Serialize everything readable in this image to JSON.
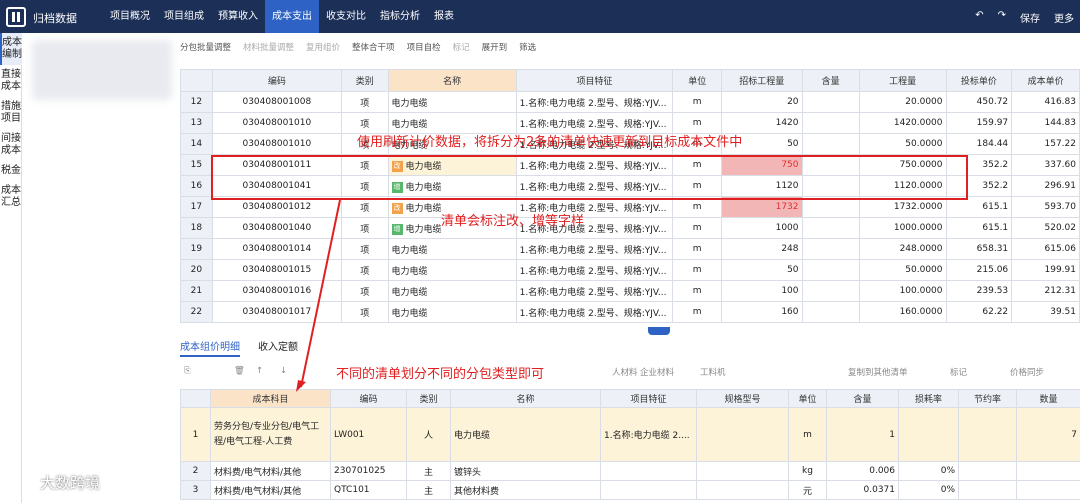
{
  "app": {
    "title": "归档数据"
  },
  "tabs": [
    "项目概况",
    "项目组成",
    "预算收入",
    "成本支出",
    "收支对比",
    "指标分析",
    "报表"
  ],
  "top_actions": [
    "↶",
    "↷",
    "保存",
    "更多"
  ],
  "left_nav": [
    "成本编制",
    "直接成本",
    "措施项目",
    "间接成本",
    "税金",
    "成本汇总"
  ],
  "toolbar": [
    "分包批量调整",
    "材料批量调整",
    "复用组价",
    "整体合干项",
    "项目自检",
    "标记",
    "展开到",
    "筛选"
  ],
  "grid1": {
    "headers": [
      "编码",
      "类别",
      "名称",
      "项目特征",
      "单位",
      "招标工程量",
      "含量",
      "工程量",
      "投标单价",
      "成本单价"
    ],
    "rows": [
      [
        "12",
        "030408001008",
        "项",
        "电力电缆",
        "1.名称:电力电缆 2.型号、规格:YJV...",
        "m",
        "20",
        "",
        "20.0000",
        "450.72",
        "416.83"
      ],
      [
        "13",
        "030408001010",
        "项",
        "电力电缆",
        "1.名称:电力电缆 2.型号、规格:YJV...",
        "m",
        "1420",
        "",
        "1420.0000",
        "159.97",
        "144.83"
      ],
      [
        "14",
        "030408001010",
        "项",
        "电力电缆",
        "1.名称:电力电缆 2.型号、规格:YJV...",
        "m",
        "50",
        "",
        "50.0000",
        "184.44",
        "157.22"
      ],
      [
        "15",
        "030408001011",
        "项",
        "电力电缆",
        "1.名称:电力电缆 2.型号、规格:YJV...",
        "m",
        "750",
        "",
        "750.0000",
        "352.2",
        "337.60"
      ],
      [
        "16",
        "030408001041",
        "项",
        "电力电缆",
        "1.名称:电力电缆 2.型号、规格:YJV...",
        "m",
        "1120",
        "",
        "1120.0000",
        "352.2",
        "296.91"
      ],
      [
        "17",
        "030408001012",
        "项",
        "电力电缆",
        "1.名称:电力电缆 2.型号、规格:YJV...",
        "m",
        "1732",
        "",
        "1732.0000",
        "615.1",
        "593.70"
      ],
      [
        "18",
        "030408001040",
        "项",
        "电力电缆",
        "1.名称:电力电缆 2.型号、规格:YJV...",
        "m",
        "1000",
        "",
        "1000.0000",
        "615.1",
        "520.02"
      ],
      [
        "19",
        "030408001014",
        "项",
        "电力电缆",
        "1.名称:电力电缆 2.型号、规格:YJV...",
        "m",
        "248",
        "",
        "248.0000",
        "658.31",
        "615.06"
      ],
      [
        "20",
        "030408001015",
        "项",
        "电力电缆",
        "1.名称:电力电缆 2.型号、规格:YJV...",
        "m",
        "50",
        "",
        "50.0000",
        "215.06",
        "199.91"
      ],
      [
        "21",
        "030408001016",
        "项",
        "电力电缆",
        "1.名称:电力电缆 2.型号、规格:YJV...",
        "m",
        "100",
        "",
        "100.0000",
        "239.53",
        "212.31"
      ],
      [
        "22",
        "030408001017",
        "项",
        "电力电缆",
        "1.名称:电力电缆 2.型号、规格:YJV...",
        "m",
        "160",
        "",
        "160.0000",
        "62.22",
        "39.51"
      ]
    ],
    "tags": {
      "15": "改",
      "16": "增",
      "17": "改",
      "18": "增"
    }
  },
  "subtabs": [
    "成本组价明细",
    "收入定额"
  ],
  "subbar": [
    "复制到其他清单",
    "标记",
    "价格同步",
    "人材料",
    "企业材料",
    "工料机"
  ],
  "grid2": {
    "headers": [
      "成本科目",
      "编码",
      "类别",
      "名称",
      "项目特征",
      "规格型号",
      "单位",
      "含量",
      "损耗率",
      "节约率",
      "数量"
    ],
    "rows": [
      [
        "1",
        "劳务分包/专业分包/电气工程/电气工程-人工费",
        "LW001",
        "人",
        "电力电缆",
        "1.名称:电力电缆 2....",
        "",
        "m",
        "1",
        "",
        "",
        "7"
      ],
      [
        "2",
        "材料费/电气材料/其他",
        "230701025",
        "主",
        "镀锌头",
        "",
        "",
        "kg",
        "0.006",
        "0%",
        "",
        ""
      ],
      [
        "3",
        "材料费/电气材料/其他",
        "QTC101",
        "主",
        "其他材料费",
        "",
        "",
        "元",
        "0.0371",
        "0%",
        "",
        ""
      ]
    ]
  },
  "annotations": [
    "使用刷新计价数据，将拆分为2条的清单快速更新到目标成本文件中",
    "清单会标注改、增等字样",
    "不同的清单划分不同的分包类型即可"
  ],
  "watermark": "大数跨境"
}
